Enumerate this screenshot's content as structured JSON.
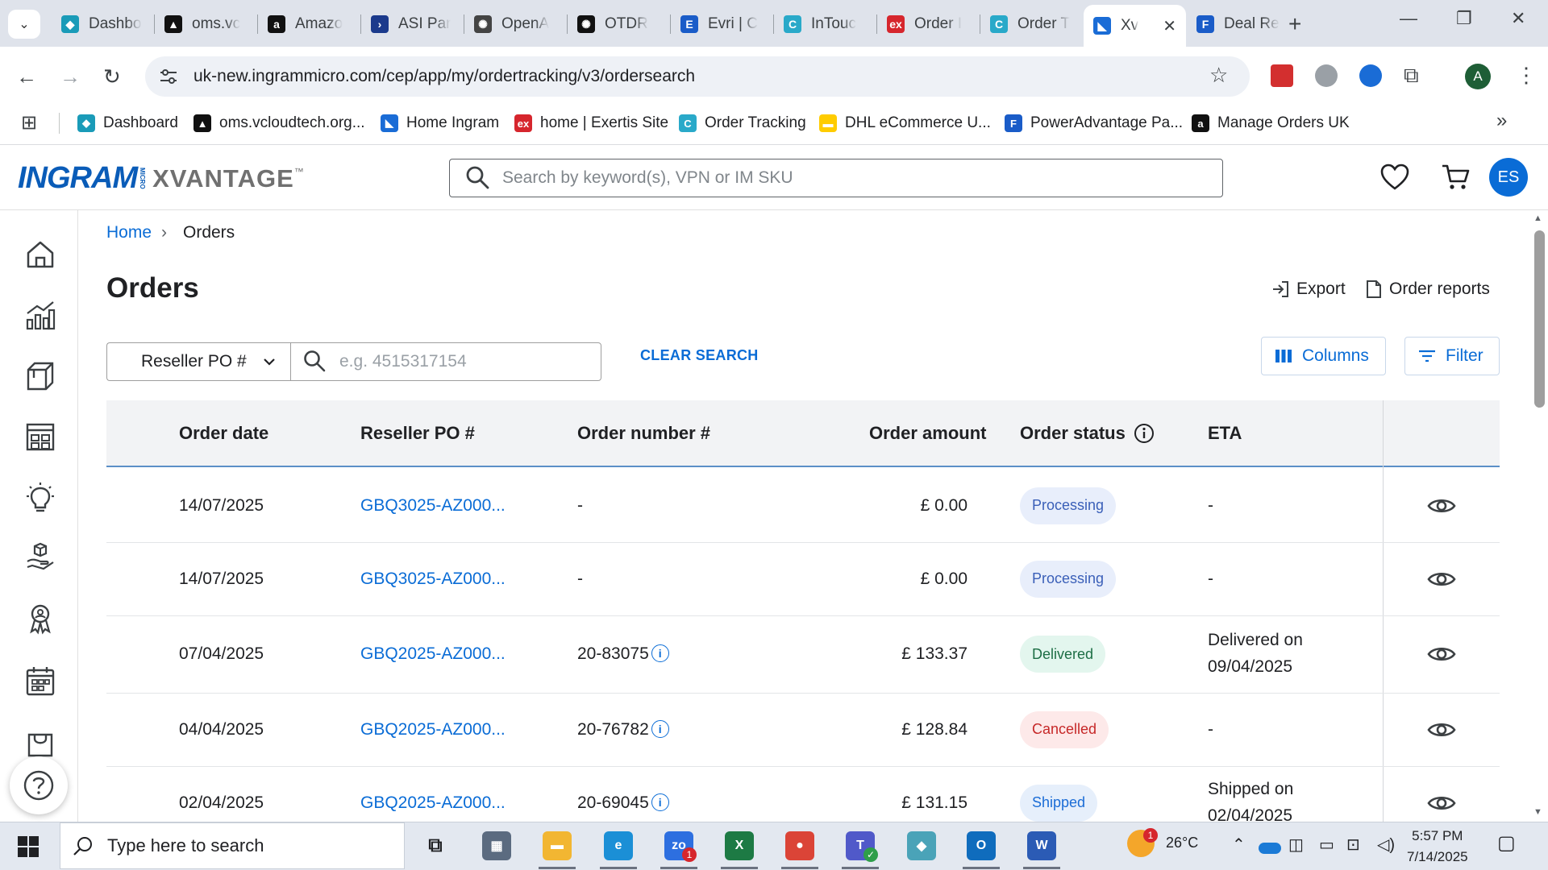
{
  "browser": {
    "tabs": [
      {
        "label": "Dashbo",
        "icon": "tab-favicon-dashboard",
        "color": "#1a9bb8",
        "glyph": "◆"
      },
      {
        "label": "oms.vc",
        "icon": "tab-favicon-oms",
        "color": "#111111",
        "glyph": "▲"
      },
      {
        "label": "Amazo",
        "icon": "tab-favicon-amazon",
        "color": "#111111",
        "glyph": "a"
      },
      {
        "label": "ASI Par",
        "icon": "tab-favicon-asi",
        "color": "#1b3a8c",
        "glyph": "›"
      },
      {
        "label": "OpenA",
        "icon": "tab-favicon-openai",
        "color": "#444444",
        "glyph": "✺"
      },
      {
        "label": "OTDR",
        "icon": "tab-favicon-otdr",
        "color": "#111111",
        "glyph": "✺"
      },
      {
        "label": "Evri | C",
        "icon": "tab-favicon-evri",
        "color": "#1a5cc8",
        "glyph": "E"
      },
      {
        "label": "InTouc",
        "icon": "tab-favicon-intouch",
        "color": "#29a9c9",
        "glyph": "C"
      },
      {
        "label": "Order I",
        "icon": "tab-favicon-exertis",
        "color": "#d6262d",
        "glyph": "ex"
      },
      {
        "label": "Order T",
        "icon": "tab-favicon-ordertracking",
        "color": "#29a9c9",
        "glyph": "C"
      },
      {
        "label": "Xv",
        "icon": "tab-favicon-xvantage",
        "color": "#1a6cd6",
        "glyph": "◣",
        "active": true
      },
      {
        "label": "Deal Re",
        "icon": "tab-favicon-deal",
        "color": "#1a5cc8",
        "glyph": "F"
      }
    ],
    "url": "uk-new.ingrammicro.com/cep/app/my/ordertracking/v3/ordersearch",
    "profile_initial": "A",
    "bookmarks": [
      {
        "label": "Dashboard",
        "color": "#1a9bb8",
        "glyph": "◆"
      },
      {
        "label": "oms.vcloudtech.org...",
        "color": "#111111",
        "glyph": "▲"
      },
      {
        "label": "Home Ingram",
        "color": "#1a6cd6",
        "glyph": "◣"
      },
      {
        "label": "home | Exertis Site",
        "color": "#d6262d",
        "glyph": "ex"
      },
      {
        "label": "Order Tracking",
        "color": "#29a9c9",
        "glyph": "C"
      },
      {
        "label": "DHL eCommerce U...",
        "color": "#ffcc00",
        "glyph": "▬"
      },
      {
        "label": "PowerAdvantage Pa...",
        "color": "#1a5cc8",
        "glyph": "F"
      },
      {
        "label": "Manage Orders UK",
        "color": "#111111",
        "glyph": "a"
      }
    ]
  },
  "header": {
    "logo_ingram": "INGRAM",
    "logo_micro": "MICRO",
    "logo_xvantage": "XVANTAGE",
    "logo_tm": "™",
    "search_placeholder": "Search by keyword(s), VPN or IM SKU",
    "user_initials": "ES"
  },
  "breadcrumb": {
    "home": "Home",
    "separator": "›",
    "current": "Orders"
  },
  "page": {
    "title": "Orders",
    "export_label": "Export",
    "reports_label": "Order reports",
    "search_type": "Reseller PO #",
    "search_placeholder": "e.g. 4515317154",
    "clear_search": "CLEAR SEARCH",
    "columns_label": "Columns",
    "filter_label": "Filter"
  },
  "table": {
    "headers": {
      "order_date": "Order date",
      "reseller_po": "Reseller PO #",
      "order_number": "Order number #",
      "order_amount": "Order amount",
      "order_status": "Order status",
      "eta": "ETA"
    },
    "rows": [
      {
        "date": "14/07/2025",
        "po": "GBQ3025-AZ000...",
        "number": "-",
        "info": false,
        "amount": "£ 0.00",
        "status": "Processing",
        "eta1": "-",
        "eta2": ""
      },
      {
        "date": "14/07/2025",
        "po": "GBQ3025-AZ000...",
        "number": "-",
        "info": false,
        "amount": "£ 0.00",
        "status": "Processing",
        "eta1": "-",
        "eta2": ""
      },
      {
        "date": "07/04/2025",
        "po": "GBQ2025-AZ000...",
        "number": "20-83075",
        "info": true,
        "amount": "£ 133.37",
        "status": "Delivered",
        "eta1": "Delivered on",
        "eta2": "09/04/2025"
      },
      {
        "date": "04/04/2025",
        "po": "GBQ2025-AZ000...",
        "number": "20-76782",
        "info": true,
        "amount": "£ 128.84",
        "status": "Cancelled",
        "eta1": "-",
        "eta2": ""
      },
      {
        "date": "02/04/2025",
        "po": "GBQ2025-AZ000...",
        "number": "20-69045",
        "info": true,
        "amount": "£ 131.15",
        "status": "Shipped",
        "eta1": "Shipped on",
        "eta2": "02/04/2025"
      }
    ],
    "info_glyph": "i"
  },
  "status_colors": {
    "Processing": {
      "bg": "#e8eefb",
      "fg": "#3a5fb8"
    },
    "Delivered": {
      "bg": "#e3f6ee",
      "fg": "#1d6e45"
    },
    "Cancelled": {
      "bg": "#fde9e9",
      "fg": "#c62828"
    },
    "Shipped": {
      "bg": "#e6effb",
      "fg": "#1a6cd6"
    }
  },
  "taskbar": {
    "search_placeholder": "Type here to search",
    "weather": "26°C",
    "weather_badge": "1",
    "teams_badge": "1",
    "time": "5:57 PM",
    "date": "7/14/2025",
    "apps": [
      {
        "name": "task-view",
        "color": "transparent",
        "glyph": "⧉"
      },
      {
        "name": "calculator",
        "color": "#5b6b80",
        "glyph": "▦"
      },
      {
        "name": "file-explorer",
        "color": "#f2b632",
        "glyph": "▬"
      },
      {
        "name": "edge",
        "color": "#1b8fd6",
        "glyph": "e"
      },
      {
        "name": "zoom",
        "color": "#2d6fe0",
        "glyph": "zo"
      },
      {
        "name": "excel",
        "color": "#1d7a44",
        "glyph": "X"
      },
      {
        "name": "chrome",
        "color": "#db4437",
        "glyph": "●"
      },
      {
        "name": "teams",
        "color": "#5059c9",
        "glyph": "T"
      },
      {
        "name": "app-diamond",
        "color": "#4aa3b8",
        "glyph": "◆"
      },
      {
        "name": "outlook",
        "color": "#0f6cbd",
        "glyph": "O"
      },
      {
        "name": "word",
        "color": "#2b5bb5",
        "glyph": "W"
      }
    ]
  }
}
